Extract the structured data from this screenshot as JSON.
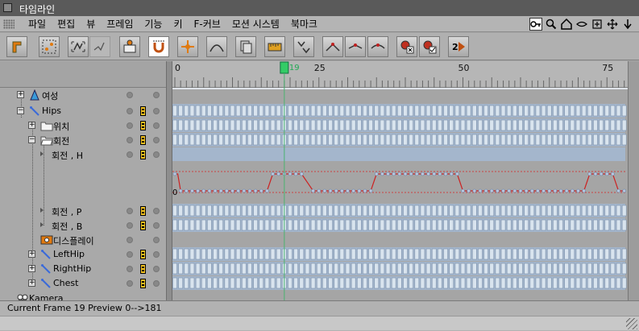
{
  "window": {
    "title": "타임라인"
  },
  "menu": {
    "items": [
      "파일",
      "편집",
      "뷰",
      "프레임",
      "기능",
      "키",
      "F-커브",
      "모션 시스템",
      "북마크"
    ]
  },
  "nav_icons": [
    "key-view-icon",
    "magnify-icon",
    "home-icon",
    "zoom-icon",
    "fit-icon",
    "move-icon",
    "arrow-down-icon"
  ],
  "toolbar": {
    "buttons": [
      "record-key-icon",
      "select-keys-icon",
      "fcurve-mode-icon",
      "linear-mode-icon",
      "take-icon",
      "magnet-snap-icon",
      "animate-icon",
      "curve-icon",
      "layer-icon",
      "ruler-icon",
      "sort-icon",
      "tangent-icon",
      "tangent-linear-icon",
      "tangent-soft-icon",
      "key-delete-icon",
      "key-ok-icon",
      "play-2x-icon"
    ]
  },
  "ruler": {
    "current_frame": 19,
    "ticks": [
      0,
      25,
      50,
      75
    ],
    "current_frame_label": "19"
  },
  "tree": {
    "rows": [
      {
        "label": "여성",
        "icon": "figure-icon"
      },
      {
        "label": "Hips",
        "icon": "bone-icon"
      },
      {
        "label": "위치",
        "icon": "folder-icon"
      },
      {
        "label": "회전",
        "icon": "folder-open-icon"
      },
      {
        "label": "회전 , H",
        "icon": ""
      },
      {
        "label": "회전 , P",
        "icon": ""
      },
      {
        "label": "회전 , B",
        "icon": ""
      },
      {
        "label": "디스플레이",
        "icon": "display-icon"
      },
      {
        "label": "LeftHip",
        "icon": "bone-icon"
      },
      {
        "label": "RightHip",
        "icon": "bone-icon"
      },
      {
        "label": "Chest",
        "icon": "bone-icon"
      },
      {
        "label": "Kamera",
        "icon": "camera-icon"
      }
    ]
  },
  "fcurve": {
    "label_zero": "0"
  },
  "status": {
    "text": "Current Frame  19  Preview  0-->181"
  },
  "colors": {
    "accent_frame": "#33cc66",
    "key_track": "#a4b6cc",
    "curve": "#cc2222",
    "guide": "#cc4444"
  }
}
